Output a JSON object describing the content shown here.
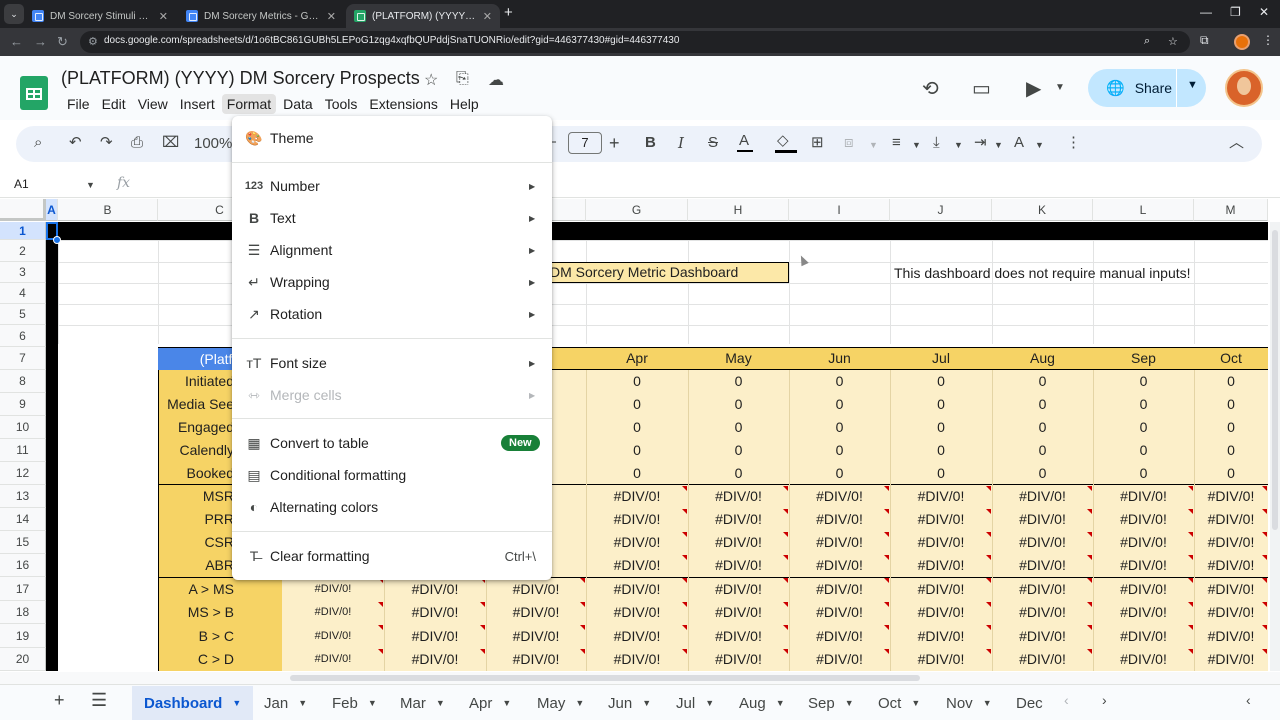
{
  "browser": {
    "tabs": [
      {
        "title": "DM Sorcery Stimuli Configurati",
        "favicon": "doc",
        "active": false
      },
      {
        "title": "DM Sorcery Metrics - Google D",
        "favicon": "doc",
        "active": false
      },
      {
        "title": "(PLATFORM) (YYYY) DM Sorcer",
        "favicon": "sheet",
        "active": true
      }
    ],
    "close_glyph": "✕",
    "new_tab": "+",
    "tab_search": "⌄",
    "url": "docs.google.com/spreadsheets/d/1o6tBC861GUBh5LEPoG1zqg4xqfbQUPddjSnaTUONRio/edit?gid=446377430#gid=446377430"
  },
  "doc": {
    "title": "(PLATFORM) (YYYY) DM Sorcery Prospects",
    "menu": [
      "File",
      "Edit",
      "View",
      "Insert",
      "Format",
      "Data",
      "Tools",
      "Extensions",
      "Help"
    ],
    "share_label": "Share"
  },
  "toolbar": {
    "zoom": "100%",
    "font_size": "7",
    "minus": "−",
    "plus": "+",
    "bold": "B",
    "italic": "I",
    "strike": "S",
    "text_color": "A"
  },
  "formula_bar": {
    "cell_ref": "A1",
    "fx": "fx"
  },
  "columns": [
    "A",
    "B",
    "C",
    "D",
    "E",
    "F",
    "G",
    "H",
    "I",
    "J",
    "K",
    "L",
    "M"
  ],
  "rows": [
    "1",
    "2",
    "3",
    "4",
    "5",
    "6",
    "7",
    "8",
    "9",
    "10",
    "11",
    "12",
    "13",
    "14",
    "15",
    "16",
    "17",
    "18",
    "19",
    "20"
  ],
  "sheet": {
    "dashboard_title": "DM Sorcery Metric Dashboard",
    "note": "This dashboard does not require manual inputs!",
    "platform_header": "(Platfo",
    "month_headers": [
      "Apr",
      "May",
      "Jun",
      "Jul",
      "Aug",
      "Sep",
      "Oct"
    ],
    "row_labels": [
      "Initiated",
      "Media See",
      "Engaged",
      "Calendly",
      "Booked",
      "MSR",
      "PRR",
      "CSR",
      "ABR",
      "A > MS",
      "MS > B",
      "B > C",
      "C > D"
    ],
    "zero_value": "0",
    "error_value": "#DIV/0!"
  },
  "format_menu": {
    "items": [
      {
        "label": "Theme",
        "icon": "palette-icon",
        "glyph": "🎨"
      },
      {
        "label": "Number",
        "icon": "number-format-icon",
        "glyph": "123",
        "submenu": true
      },
      {
        "label": "Text",
        "icon": "bold-text-icon",
        "glyph": "B",
        "submenu": true
      },
      {
        "label": "Alignment",
        "icon": "align-left-icon",
        "glyph": "☰",
        "submenu": true
      },
      {
        "label": "Wrapping",
        "icon": "wrap-icon",
        "glyph": "↵",
        "submenu": true
      },
      {
        "label": "Rotation",
        "icon": "rotation-icon",
        "glyph": "↗",
        "submenu": true
      },
      {
        "label": "Font size",
        "icon": "font-size-icon",
        "glyph": "тT",
        "submenu": true
      },
      {
        "label": "Merge cells",
        "icon": "merge-icon",
        "glyph": "⇿",
        "submenu": true,
        "disabled": true
      },
      {
        "label": "Convert to table",
        "icon": "table-icon",
        "glyph": "▦",
        "badge": "New"
      },
      {
        "label": "Conditional formatting",
        "icon": "paint-roller-icon",
        "glyph": "▤"
      },
      {
        "label": "Alternating colors",
        "icon": "drop-icon",
        "glyph": "◐"
      },
      {
        "label": "Clear formatting",
        "icon": "clear-format-icon",
        "glyph": "T̶",
        "shortcut": "Ctrl+\\"
      }
    ],
    "submenu_arrow": "▶"
  },
  "sheet_tabs": {
    "active": "Dashboard",
    "tabs": [
      "Jan",
      "Feb",
      "Mar",
      "Apr",
      "May",
      "Jun",
      "Jul",
      "Aug",
      "Sep",
      "Oct",
      "Nov",
      "Dec"
    ]
  },
  "colors": {
    "accent": "#0b57d0",
    "share_bg": "#c2e7ff",
    "header_yellow": "#f6d365",
    "value_yellow": "#fcefc9",
    "platform_blue": "#4a86e8",
    "new_badge": "#188038",
    "error_marker": "#cc0000"
  }
}
